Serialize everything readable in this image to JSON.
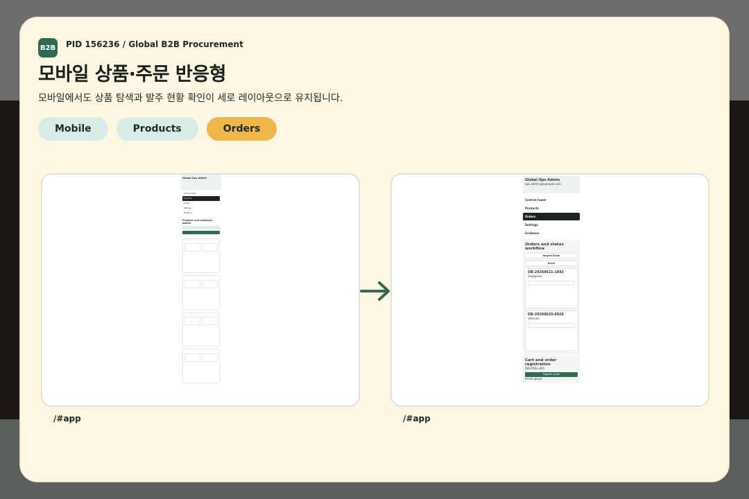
{
  "header": {
    "logo_text": "B2B",
    "pid": "PID 156236 / Global B2B Procurement",
    "title": "모바일 상품·주문 반응형",
    "subtitle": "모바일에서도 상품 탐색과 발주 현황 확인이 세로 레이아웃으로 유지됩니다."
  },
  "tags": [
    "Mobile",
    "Products",
    "Orders"
  ],
  "frames": {
    "left_path": "/#app",
    "right_path": "/#app"
  },
  "left_phone": {
    "admin": "Global Ops Admin",
    "nav": [
      "Control tower",
      "Products",
      "Orders",
      "Settings",
      "Evidence"
    ],
    "section_title": "Product and material admin",
    "validate": "Validate batch",
    "add": "Add SKU"
  },
  "right_phone": {
    "admin": "Global Ops Admin",
    "admin_sub": "ops.admin@example.com",
    "nav": [
      "Control tower",
      "Products",
      "Orders",
      "Settings",
      "Evidence"
    ],
    "section_title": "Orders and status workflow",
    "import_label": "Import Excel",
    "export_label": "Excel",
    "orders": [
      {
        "id": "OB-20260621-1842",
        "sub": "Singapore"
      },
      {
        "id": "OB-20260620-0926",
        "sub": "Vietnam"
      }
    ],
    "cart_title": "Cart and order registration",
    "sku": "FBV-ROLL-001",
    "register": "Register order",
    "queue_title": "Email queue"
  },
  "colors": {
    "accent": "#2f6b52",
    "gold": "#efb74a",
    "mint": "#d7ece6"
  }
}
